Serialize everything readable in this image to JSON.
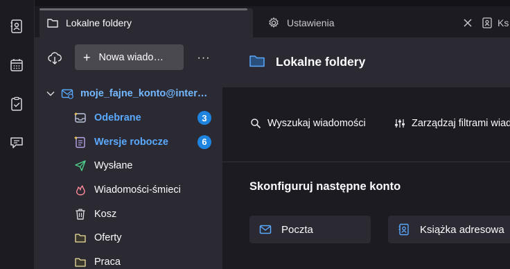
{
  "spaces": {
    "items": [
      {
        "icon": "address-book-icon"
      },
      {
        "icon": "calendar-icon"
      },
      {
        "icon": "tasks-icon"
      },
      {
        "icon": "chat-icon"
      }
    ]
  },
  "tabs": [
    {
      "label": "Lokalne foldery",
      "icon": "folder-icon",
      "active": true
    },
    {
      "label": "Ustawienia",
      "icon": "gear-icon",
      "active": false
    },
    {
      "label": "Ks",
      "icon": "address-book-icon",
      "active": false
    }
  ],
  "folder_pane": {
    "new_message_label": "Nowa wiado…",
    "more_label": "···",
    "account": "moje_fajne_konto@inter…",
    "folders": [
      {
        "label": "Odebrane",
        "unread": "3",
        "icon": "inbox-icon"
      },
      {
        "label": "Wersje robocze",
        "unread": "6",
        "icon": "drafts-icon"
      },
      {
        "label": "Wysłane",
        "unread": null,
        "icon": "sent-icon"
      },
      {
        "label": "Wiadomości-śmieci",
        "unread": null,
        "icon": "junk-icon"
      },
      {
        "label": "Kosz",
        "unread": null,
        "icon": "trash-icon"
      },
      {
        "label": "Oferty",
        "unread": null,
        "icon": "folder-icon"
      },
      {
        "label": "Praca",
        "unread": null,
        "icon": "folder-icon"
      }
    ]
  },
  "main": {
    "title": "Lokalne foldery",
    "actions": [
      {
        "label": "Wyszukaj wiadomości",
        "icon": "search-icon"
      },
      {
        "label": "Zarządzaj filtrami wiad",
        "icon": "filter-icon"
      }
    ],
    "setup_title": "Skonfiguruj następne konto",
    "setup_cards": [
      {
        "label": "Poczta",
        "icon": "mail-icon"
      },
      {
        "label": "Książka adresowa",
        "icon": "address-book-icon"
      }
    ]
  },
  "colors": {
    "accent": "#1f83e0",
    "account_text": "#74b9ff",
    "unread_text": "#5aa9ff"
  }
}
